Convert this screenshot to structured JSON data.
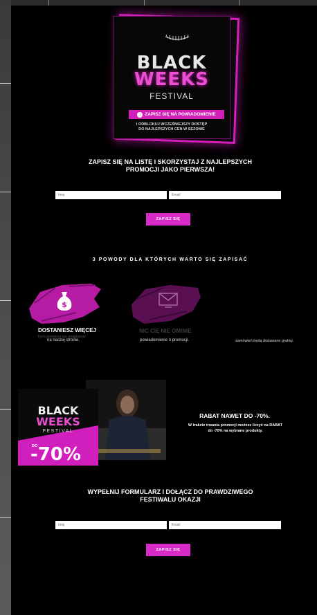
{
  "hero": {
    "title_line1": "BLACK",
    "title_line2": "WEEKS",
    "subtitle": "FESTIVAL",
    "notify_button": "ZAPISZ SIĘ NA POWIADOMIENIE",
    "note_line1": "I ODBLOKUJ WCZEŚNIEJSZY DOSTĘP",
    "note_line2": "DO NAJLEPSZYCH CEN W SEZONIE"
  },
  "signup1": {
    "heading_line1": "ZAPISZ SIĘ NA LISTĘ I SKORZYSTAJ Z NAJLEPSZYCH",
    "heading_line2": "PROMOCJI JAKO PIERWSZA!",
    "name_placeholder": "Imię",
    "email_placeholder": "Email",
    "submit": "ZAPISZ SIĘ"
  },
  "reasons": {
    "heading": "3 POWODY DLA KTÓRYCH WARTO SIĘ ZAPISAĆ",
    "items": [
      {
        "title": "DOSTANIESZ WIĘCEJ",
        "text_faded": "Tych promocji nie znajdziesz",
        "text": "na naszej stronie.",
        "icon": "money-bag-icon"
      },
      {
        "title": "NIC CIĘ NIE OMINIE",
        "text": "powiadomienie o promocji.",
        "icon": "envelope-icon"
      },
      {
        "title": "",
        "text": "zamówień będą dodawane gratisy.",
        "icon": ""
      }
    ]
  },
  "promo": {
    "card_black": "BLACK",
    "card_weeks": "WEEKS",
    "card_festival": "FESTIVAL",
    "card_do": "DO",
    "card_percent": "-70%",
    "title": "RABAT NAWET DO -70%.",
    "text_line1": "W trakcie trwania promocji możesz liczyć na RABAT",
    "text_line2": "do -70% na wybrane produkty."
  },
  "signup2": {
    "heading_line1": "WYPEŁNIJ FORMULARZ I DOŁĄCZ DO PRAWDZIWEGO",
    "heading_line2": "FESTIWALU OKAZJI",
    "name_placeholder": "Imię",
    "email_placeholder": "Email",
    "submit": "ZAPISZ SIĘ"
  },
  "colors": {
    "accent": "#d72ac7",
    "background": "#000000",
    "gutter": "#4a4a4a"
  }
}
